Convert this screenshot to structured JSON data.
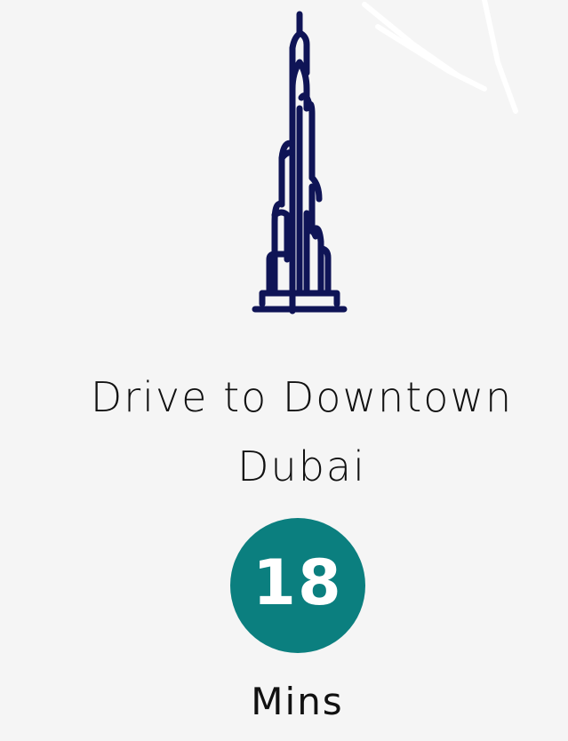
{
  "icons": {
    "tower": "burj-khalifa-tower-icon",
    "watermark": "faded-watermark-icon"
  },
  "colors": {
    "background": "#f5f5f5",
    "icon_stroke": "#0f1456",
    "badge": "#0b7f7f",
    "badge_text": "#ffffff",
    "text": "#111111"
  },
  "destination": {
    "line1": "Drive to Downtown",
    "line2": "Dubai"
  },
  "duration": {
    "value": "18",
    "unit": "Mins"
  }
}
